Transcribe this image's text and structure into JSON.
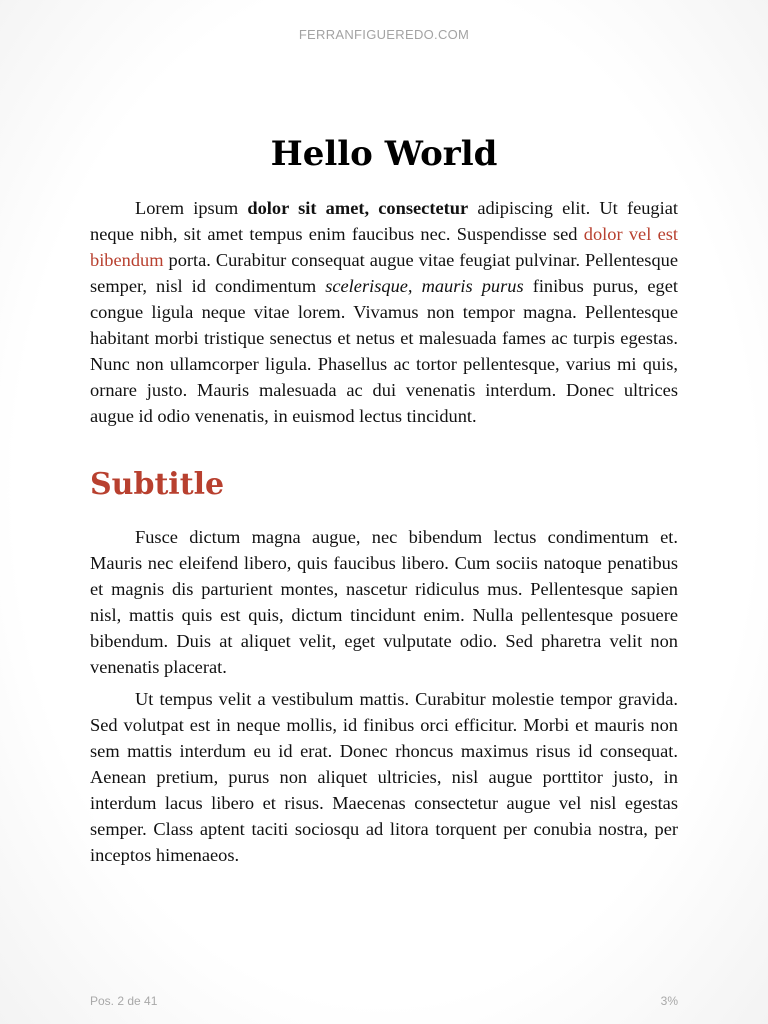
{
  "header": {
    "running_title": "FERRANFIGUEREDO.COM"
  },
  "chapter": {
    "title": "Hello World",
    "p1": {
      "t1": "Lorem ipsum ",
      "bold": "dolor sit amet, consectetur",
      "t2": " adipiscing elit. Ut feugiat neque nibh, sit amet tempus enim faucibus nec. Suspendisse sed ",
      "link": "dolor vel est bibendum",
      "t3": " porta. Curabitur consequat augue vitae feugiat pulvinar. Pellentesque semper, nisl id condimentum ",
      "italic": "scelerisque, mauris purus",
      "t4": " finibus purus, eget congue ligula neque vitae lorem. Vivamus non tempor magna. Pellentesque habitant morbi tristique senectus et netus et malesuada fames ac turpis egestas. Nunc non ullamcorper ligula. Phasellus ac tortor pellentesque, varius mi quis, ornare justo. Mauris malesuada ac dui venenatis interdum. Donec ultrices augue id odio venenatis, in euismod lectus tincidunt."
    }
  },
  "section": {
    "subtitle": "Subtitle",
    "p2": "Fusce dictum magna augue, nec bibendum lectus condimentum et. Mauris nec eleifend libero, quis faucibus libero. Cum sociis natoque penatibus et magnis dis parturient montes, nascetur ridiculus mus. Pellentesque sapien nisl, mattis quis est quis, dictum tincidunt enim. Nulla pellentesque posuere bibendum. Duis at aliquet velit, eget vulputate odio. Sed pharetra velit non venenatis placerat.",
    "p3": "Ut tempus velit a vestibulum mattis. Curabitur molestie tempor gravida. Sed volutpat est in neque mollis, id finibus orci efficitur. Morbi et mauris non sem mattis interdum eu id erat. Donec rhoncus maximus risus id consequat. Aenean pretium, purus non aliquet ultricies, nisl augue porttitor justo, in interdum lacus libero et risus. Maecenas consectetur augue vel nisl egestas semper. Class aptent taciti sociosqu ad litora torquent per conubia nostra, per inceptos himenaeos."
  },
  "footer": {
    "position": "Pos. 2 de 41",
    "progress": "3%"
  },
  "colors": {
    "accent": "#b8402f",
    "text": "#111111",
    "muted": "#a8a8a8"
  }
}
